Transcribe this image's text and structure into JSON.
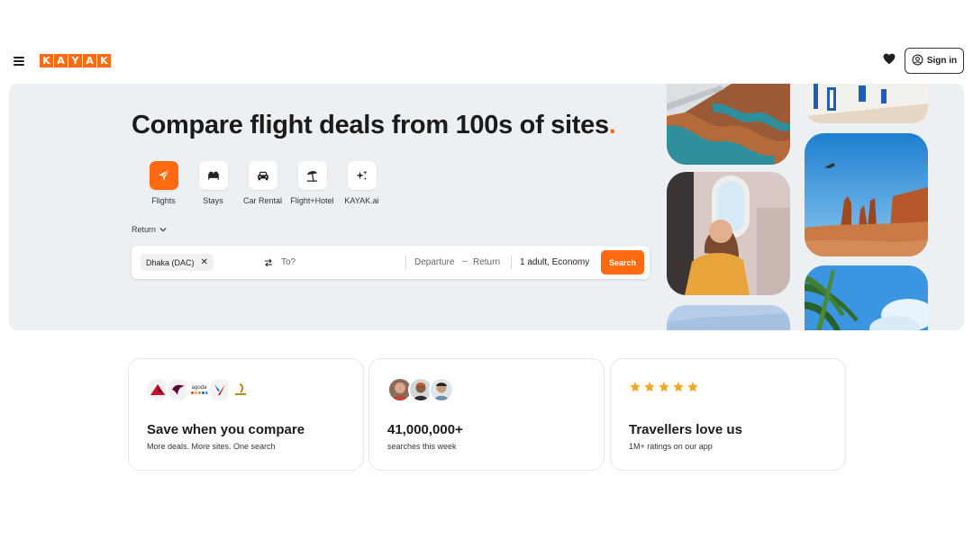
{
  "header": {
    "logo_letters": [
      "K",
      "A",
      "Y",
      "A",
      "K"
    ],
    "signin_label": "Sign in"
  },
  "hero": {
    "title": "Compare flight deals from 100s of sites",
    "title_dot": ".",
    "verticals": [
      {
        "label": "Flights",
        "icon": "plane-icon",
        "active": true
      },
      {
        "label": "Stays",
        "icon": "bed-icon",
        "active": false
      },
      {
        "label": "Car Rental",
        "icon": "car-icon",
        "active": false
      },
      {
        "label": "Flight+Hotel",
        "icon": "beach-umbrella-icon",
        "active": false
      },
      {
        "label": "KAYAK.ai",
        "icon": "sparkle-icon",
        "active": false
      }
    ],
    "trip_type": "Return"
  },
  "search": {
    "origin": "Dhaka (DAC)",
    "destination_placeholder": "To?",
    "departure": "Departure",
    "return": "Return",
    "date_separator": "–",
    "travellers": "1 adult, Economy",
    "button": "Search"
  },
  "cards": [
    {
      "title": "Save when you compare",
      "subtitle": "More deals. More sites. One search",
      "badge_text": "agoda"
    },
    {
      "title": "41,000,000+",
      "subtitle": "searches this week"
    },
    {
      "title": "Travellers love us",
      "subtitle": "1M+ ratings on our app",
      "rating_stars": 5
    }
  ],
  "colors": {
    "brand": "#ff690f",
    "hero_bg": "#edf0f3",
    "star": "#f5a623"
  }
}
